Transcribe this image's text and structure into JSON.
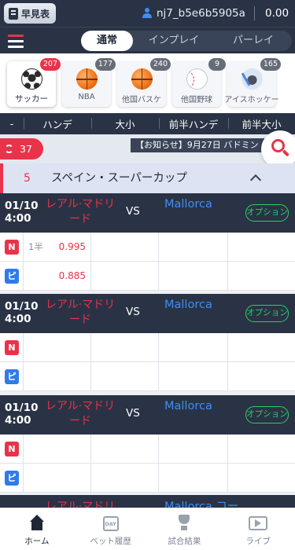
{
  "header": {
    "schedule_label": "早見表",
    "username": "nj7_b5e6b5905a",
    "balance": "0.00"
  },
  "modes": [
    "通常",
    "インプレイ",
    "パーレイ"
  ],
  "sports": [
    {
      "label": "サッカー",
      "count": "207",
      "icon": "soccer-ball-icon"
    },
    {
      "label": "NBA",
      "count": "177",
      "icon": "basketball-icon"
    },
    {
      "label": "他国バスケ",
      "count": "240",
      "icon": "basketball-icon"
    },
    {
      "label": "他国野球",
      "count": "9",
      "icon": "baseball-icon"
    },
    {
      "label": "アイスホッケー",
      "count": "165",
      "icon": "hockey-icon"
    }
  ],
  "columns": [
    "-",
    "ハンデ",
    "大小",
    "前半ハンデ",
    "前半大小"
  ],
  "live_count": "37",
  "notice": "【お知らせ】9月27日 バドミン",
  "league": {
    "count": "5",
    "name": "スペイン・スーパーカップ"
  },
  "matches": [
    {
      "date": "01/10",
      "time": "4:00",
      "home": "レアル·マドリード",
      "vs": "VS",
      "away": "Mallorca",
      "option": "オプション",
      "half_label": "1半",
      "odds_top": "0.995",
      "odds_bottom": "0.885",
      "tag_top": "N",
      "tag_bottom": "ピ"
    },
    {
      "date": "01/10",
      "time": "4:00",
      "home": "レアル·マドリード",
      "vs": "VS",
      "away": "Mallorca",
      "option": "オプション",
      "half_label": "",
      "odds_top": "",
      "odds_bottom": "",
      "tag_top": "N",
      "tag_bottom": "ピ"
    },
    {
      "date": "01/10",
      "time": "4:00",
      "home": "レアル·マドリード",
      "vs": "VS",
      "away": "Mallorca",
      "option": "オプション",
      "half_label": "",
      "odds_top": "",
      "odds_bottom": "",
      "tag_top": "N",
      "tag_bottom": "ピ"
    }
  ],
  "peek": {
    "home": "レアル·マドリード",
    "away": "Mallorca コー"
  },
  "bottom_nav": [
    "ホーム",
    "ベット履歴",
    "試合結果",
    "ライブ"
  ],
  "colors": {
    "accent": "#e8334a",
    "header_bg": "#2a3345",
    "away_blue": "#3d8ef5",
    "option_green": "#2bcf64"
  }
}
